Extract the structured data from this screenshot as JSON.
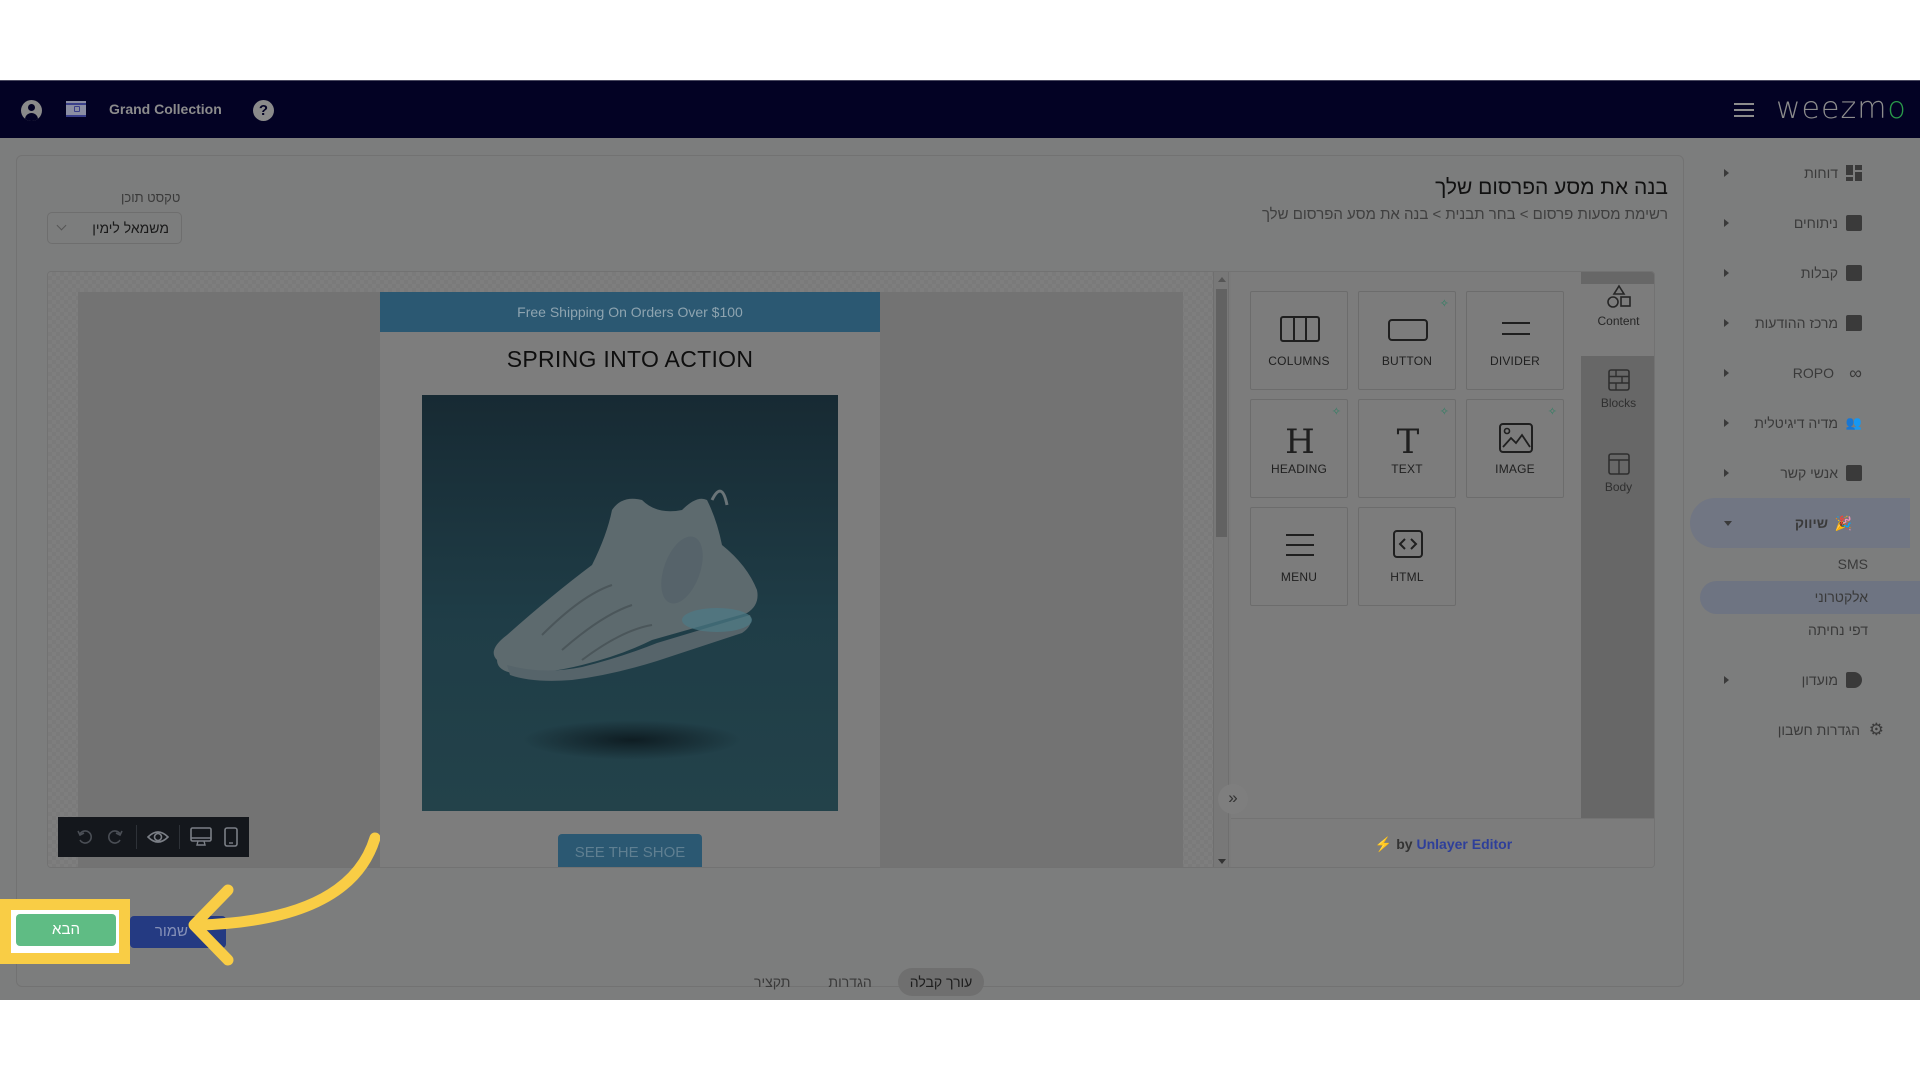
{
  "topbar": {
    "store_name": "Grand Collection",
    "help_label": "?",
    "logo_main": "weezm",
    "logo_accent": "o"
  },
  "header": {
    "title": "בנה את מסע הפרסום שלך",
    "breadcrumb": "רשימת מסעות פרסום  >  בחר תבנית  >  בנה את מסע הפרסום שלך"
  },
  "text_direction": {
    "label": "טקסט תוכן",
    "value": "משמאל לימין"
  },
  "sidebar": {
    "items": [
      {
        "label": "דוחות",
        "icon": "dashboard-icon"
      },
      {
        "label": "ניתוחים",
        "icon": "analytics-icon"
      },
      {
        "label": "קבלות",
        "icon": "receipt-icon"
      },
      {
        "label": "מרכז ההודעות",
        "icon": "chat-icon"
      },
      {
        "label": "ROPO",
        "icon": "infinity-icon"
      },
      {
        "label": "מדיה דיגיטלית",
        "icon": "people-icon"
      },
      {
        "label": "אנשי קשר",
        "icon": "contact-icon"
      },
      {
        "label": "שיווק",
        "icon": "party-popper-icon",
        "expanded": true
      },
      {
        "label": "מועדון",
        "icon": "tag-icon"
      },
      {
        "label": "הגדרות חשבון",
        "icon": "gear-icon"
      }
    ],
    "marketing_sub": [
      "SMS",
      "אלקטרוני",
      "דפי נחיתה"
    ],
    "active_sub": "אלקטרוני"
  },
  "email": {
    "shipping_bar": "Free Shipping On Orders Over $100",
    "heading": "SPRING INTO ACTION",
    "cta": "SEE THE SHOE"
  },
  "panel": {
    "tiles": [
      {
        "label": "COLUMNS",
        "icon": "columns-icon",
        "ai": false
      },
      {
        "label": "BUTTON",
        "icon": "button-icon",
        "ai": true
      },
      {
        "label": "DIVIDER",
        "icon": "divider-icon",
        "ai": false
      },
      {
        "label": "HEADING",
        "icon": "heading-icon",
        "ai": true
      },
      {
        "label": "TEXT",
        "icon": "text-icon",
        "ai": true
      },
      {
        "label": "IMAGE",
        "icon": "image-icon",
        "ai": true
      },
      {
        "label": "MENU",
        "icon": "menu-icon",
        "ai": false
      },
      {
        "label": "HTML",
        "icon": "html-icon",
        "ai": false
      }
    ],
    "tabs": [
      "Content",
      "Blocks",
      "Body"
    ],
    "active_tab": "Content",
    "footer_by": "by",
    "footer_brand": "Unlayer Editor",
    "collapse_label": "»"
  },
  "bottom_tabs": [
    "עורך קבלה",
    "הגדרות",
    "תקציר"
  ],
  "active_bottom_tab": "עורך קבלה",
  "buttons": {
    "next": "הבא",
    "save": "שמור"
  },
  "colors": {
    "topbar_bg": "#030224",
    "next_button": "#5fbc84",
    "save_button": "#243a82",
    "highlight": "#f9cd45",
    "brand_accent": "#2a9a4a",
    "email_banner": "#2b5872"
  }
}
